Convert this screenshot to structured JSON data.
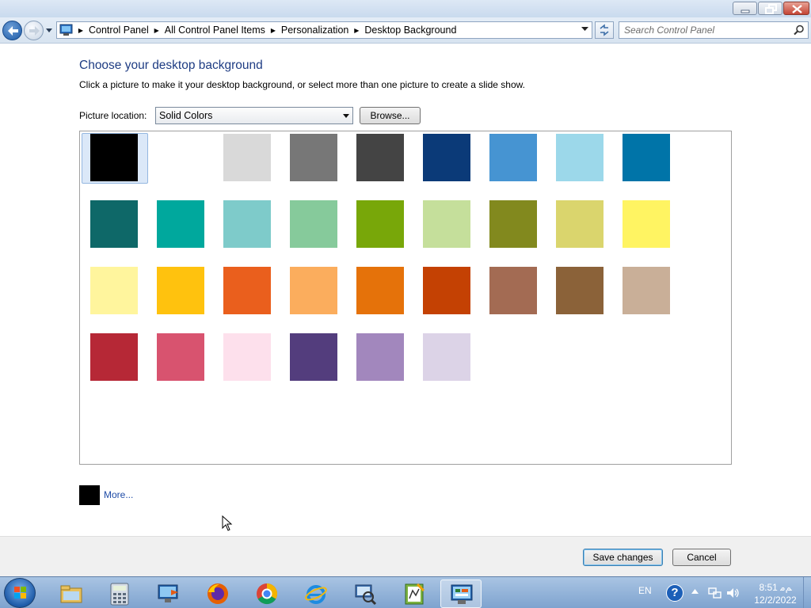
{
  "window": {
    "controls": {
      "minimize": "minimize",
      "maximize": "maximize",
      "close": "close"
    }
  },
  "address_bar": {
    "crumbs": [
      "Control Panel",
      "All Control Panel Items",
      "Personalization",
      "Desktop Background"
    ],
    "search_placeholder": "Search Control Panel"
  },
  "content": {
    "title": "Choose your desktop background",
    "instructions": "Click a picture to make it your desktop background, or select more than one picture to create a slide show.",
    "picture_location_label": "Picture location:",
    "picture_location_value": "Solid Colors",
    "browse_label": "Browse...",
    "more_label": "More...",
    "more_color": "#000000",
    "selected_index": 0,
    "colors": [
      "#000000",
      "#ffffff",
      "#d9d9d9",
      "#777777",
      "#444444",
      "#0b3a78",
      "#4694d2",
      "#9cd8ea",
      "#0074a8",
      "#0e6868",
      "#00a89d",
      "#7ecbca",
      "#86ca9b",
      "#78a709",
      "#c5df9b",
      "#82891e",
      "#dad56d",
      "#fff462",
      "#fff59d",
      "#ffc20e",
      "#ea5f1d",
      "#fbad5d",
      "#e5720a",
      "#c44103",
      "#a36b53",
      "#8b6239",
      "#c9af98",
      "#b62836",
      "#d8536f",
      "#fde0ec",
      "#533d7d",
      "#a287bd",
      "#dcd3e7"
    ]
  },
  "footer": {
    "save_label": "Save changes",
    "cancel_label": "Cancel"
  },
  "taskbar": {
    "apps": [
      "file-explorer-icon",
      "calculator-icon",
      "remote-desktop-icon",
      "firefox-icon",
      "chrome-icon",
      "internet-explorer-icon",
      "network-scan-icon",
      "media-editor-icon",
      "control-panel-icon"
    ],
    "language": "EN",
    "help_glyph": "?",
    "time": "8:51 ﻢﻣ",
    "date": "12/2/2022"
  }
}
